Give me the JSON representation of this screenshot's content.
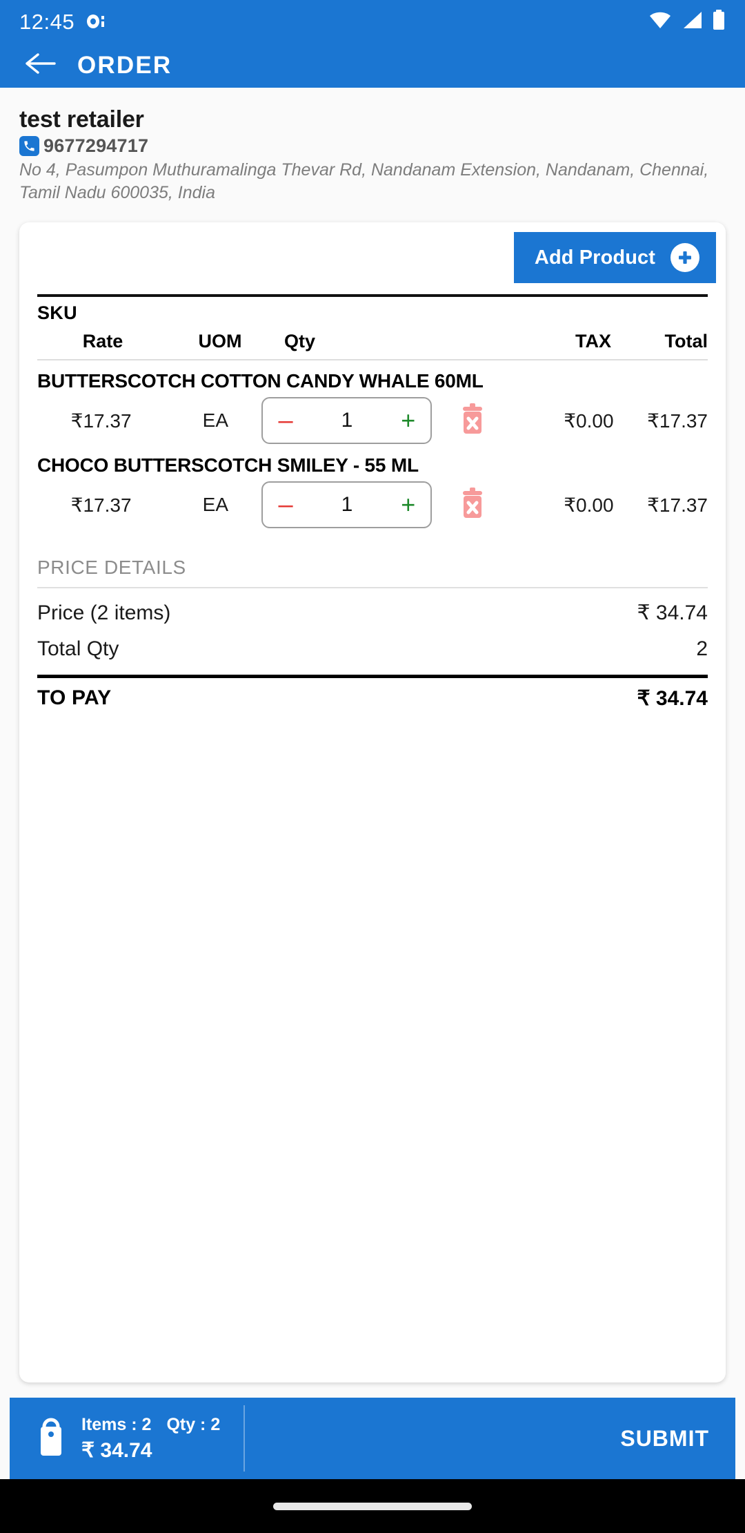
{
  "status_bar": {
    "time": "12:45",
    "notification_icon": "camera-notification-icon",
    "wifi_icon": "wifi-icon",
    "signal_icon": "cellular-signal-icon",
    "battery_icon": "battery-icon"
  },
  "app_bar": {
    "back_icon": "arrow-left-icon",
    "title": "ORDER",
    "background_color": "#1b76d2"
  },
  "retailer": {
    "name": "test retailer",
    "phone_icon": "phone-icon",
    "phone": "9677294717",
    "address": "No 4, Pasumpon Muthuramalinga Thevar Rd, Nandanam Extension, Nandanam, Chennai, Tamil Nadu 600035, India"
  },
  "order_card": {
    "add_product": {
      "label": "Add Product",
      "icon": "plus-circle-icon"
    },
    "table": {
      "sku_header": "SKU",
      "headers": {
        "rate": "Rate",
        "uom": "UOM",
        "qty": "Qty",
        "tax": "TAX",
        "total": "Total"
      },
      "rows": [
        {
          "name": "BUTTERSCOTCH COTTON CANDY WHALE 60ML",
          "rate": "₹17.37",
          "uom": "EA",
          "qty": "1",
          "minus_label": "–",
          "plus_label": "+",
          "delete_icon": "delete-trash-icon",
          "tax": "₹0.00",
          "total": "₹17.37"
        },
        {
          "name": "CHOCO BUTTERSCOTCH SMILEY - 55 ML",
          "rate": "₹17.37",
          "uom": "EA",
          "qty": "1",
          "minus_label": "–",
          "plus_label": "+",
          "delete_icon": "delete-trash-icon",
          "tax": "₹0.00",
          "total": "₹17.37"
        }
      ]
    },
    "price_details": {
      "title": "PRICE DETAILS",
      "price_label": "Price (2 items)",
      "price_value": "₹ 34.74",
      "qty_label": "Total Qty",
      "qty_value": "2",
      "to_pay_label": "TO PAY",
      "to_pay_value": "₹ 34.74"
    }
  },
  "bottom_bar": {
    "bag_icon": "shopping-bag-icon",
    "items_text": "Items : 2",
    "qty_text": "Qty : 2",
    "amount": "₹ 34.74",
    "submit_label": "SUBMIT"
  },
  "colors": {
    "primary": "#1b76d2",
    "minus": "#e53935",
    "plus": "#1e8a2b",
    "delete": "#f79a9a",
    "muted": "#8c8c8c"
  }
}
